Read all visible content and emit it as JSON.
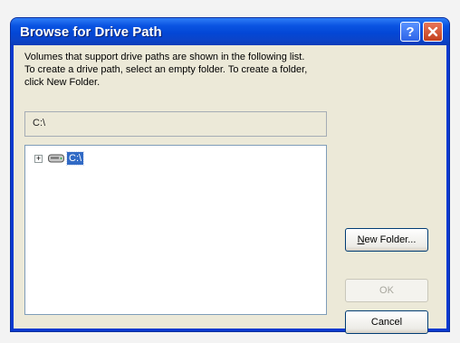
{
  "window": {
    "title": "Browse for Drive Path",
    "help_glyph": "?",
    "close_glyph": "×"
  },
  "instructions": {
    "line1": "Volumes that support drive paths are shown in the following list.",
    "line2": "To create a drive path, select an empty folder. To create a folder,",
    "line3": "click New Folder."
  },
  "path_field": {
    "value": "C:\\"
  },
  "tree": {
    "expander_glyph": "+",
    "items": [
      {
        "label": "C:\\",
        "icon": "drive-icon",
        "selected": true
      }
    ]
  },
  "buttons": {
    "new_folder": {
      "underlined": "N",
      "rest": "ew Folder..."
    },
    "ok": "OK",
    "cancel": "Cancel"
  },
  "colors": {
    "titlebar": "#0a54e2",
    "selection": "#316ac5",
    "dialog_bg": "#ece9d8"
  }
}
